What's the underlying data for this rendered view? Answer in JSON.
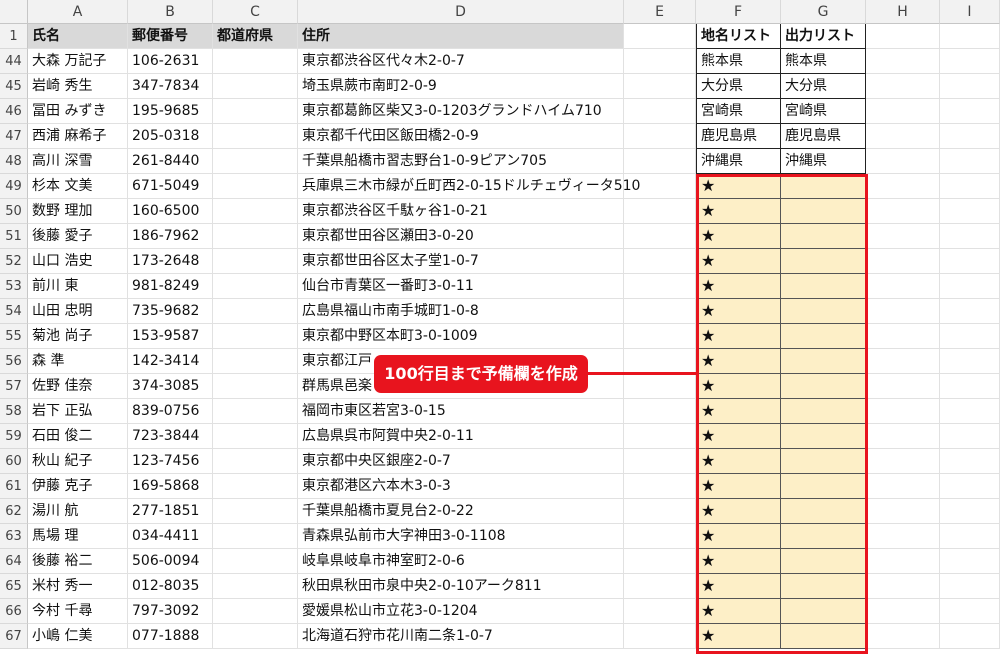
{
  "columns": [
    "A",
    "B",
    "C",
    "D",
    "E",
    "F",
    "G",
    "H",
    "I"
  ],
  "header_row": {
    "num": "1",
    "A": "氏名",
    "B": "郵便番号",
    "C": "都道府県",
    "D": "住所",
    "F": "地名リスト",
    "G": "出力リスト"
  },
  "rows": [
    {
      "num": "44",
      "name": "大森 万記子",
      "zip": "106-2631",
      "addr": "東京都渋谷区代々木2-0-7",
      "f": "熊本県",
      "g": "熊本県"
    },
    {
      "num": "45",
      "name": "岩崎 秀生",
      "zip": "347-7834",
      "addr": "埼玉県蕨市南町2-0-9",
      "f": "大分県",
      "g": "大分県"
    },
    {
      "num": "46",
      "name": "冨田 みずき",
      "zip": "195-9685",
      "addr": "東京都葛飾区柴又3-0-1203グランドハイム710",
      "f": "宮崎県",
      "g": "宮崎県"
    },
    {
      "num": "47",
      "name": "西浦 麻希子",
      "zip": "205-0318",
      "addr": "東京都千代田区飯田橋2-0-9",
      "f": "鹿児島県",
      "g": "鹿児島県"
    },
    {
      "num": "48",
      "name": "高川 深雪",
      "zip": "261-8440",
      "addr": "千葉県船橋市習志野台1-0-9ピアン705",
      "f": "沖縄県",
      "g": "沖縄県"
    },
    {
      "num": "49",
      "name": "杉本 文美",
      "zip": "671-5049",
      "addr": "兵庫県三木市緑が丘町西2-0-15ドルチェヴィータ510",
      "f": "★",
      "g": ""
    },
    {
      "num": "50",
      "name": "数野 理加",
      "zip": "160-6500",
      "addr": "東京都渋谷区千駄ヶ谷1-0-21",
      "f": "★",
      "g": ""
    },
    {
      "num": "51",
      "name": "後藤 愛子",
      "zip": "186-7962",
      "addr": "東京都世田谷区瀬田3-0-20",
      "f": "★",
      "g": ""
    },
    {
      "num": "52",
      "name": "山口 浩史",
      "zip": "173-2648",
      "addr": "東京都世田谷区太子堂1-0-7",
      "f": "★",
      "g": ""
    },
    {
      "num": "53",
      "name": "前川 東",
      "zip": "981-8249",
      "addr": "仙台市青葉区一番町3-0-11",
      "f": "★",
      "g": ""
    },
    {
      "num": "54",
      "name": "山田 忠明",
      "zip": "735-9682",
      "addr": "広島県福山市南手城町1-0-8",
      "f": "★",
      "g": ""
    },
    {
      "num": "55",
      "name": "菊池 尚子",
      "zip": "153-9587",
      "addr": "東京都中野区本町3-0-1009",
      "f": "★",
      "g": ""
    },
    {
      "num": "56",
      "name": "森 準",
      "zip": "142-3414",
      "addr": "東京都江戸",
      "f": "★",
      "g": ""
    },
    {
      "num": "57",
      "name": "佐野 佳奈",
      "zip": "374-3085",
      "addr": "群馬県邑楽",
      "f": "★",
      "g": ""
    },
    {
      "num": "58",
      "name": "岩下 正弘",
      "zip": "839-0756",
      "addr": "福岡市東区若宮3-0-15",
      "f": "★",
      "g": ""
    },
    {
      "num": "59",
      "name": "石田 俊二",
      "zip": "723-3844",
      "addr": "広島県呉市阿賀中央2-0-11",
      "f": "★",
      "g": ""
    },
    {
      "num": "60",
      "name": "秋山 紀子",
      "zip": "123-7456",
      "addr": "東京都中央区銀座2-0-7",
      "f": "★",
      "g": ""
    },
    {
      "num": "61",
      "name": "伊藤 克子",
      "zip": "169-5868",
      "addr": "東京都港区六本木3-0-3",
      "f": "★",
      "g": ""
    },
    {
      "num": "62",
      "name": "湯川 航",
      "zip": "277-1851",
      "addr": "千葉県船橋市夏見台2-0-22",
      "f": "★",
      "g": ""
    },
    {
      "num": "63",
      "name": "馬場 理",
      "zip": "034-4411",
      "addr": "青森県弘前市大字神田3-0-1108",
      "f": "★",
      "g": ""
    },
    {
      "num": "64",
      "name": "後藤 裕二",
      "zip": "506-0094",
      "addr": "岐阜県岐阜市神室町2-0-6",
      "f": "★",
      "g": ""
    },
    {
      "num": "65",
      "name": "米村 秀一",
      "zip": "012-8035",
      "addr": "秋田県秋田市泉中央2-0-10アーク811",
      "f": "★",
      "g": ""
    },
    {
      "num": "66",
      "name": "今村 千尋",
      "zip": "797-3092",
      "addr": "愛媛県松山市立花3-0-1204",
      "f": "★",
      "g": ""
    },
    {
      "num": "67",
      "name": "小嶋 仁美",
      "zip": "077-1888",
      "addr": "北海道石狩市花川南二条1-0-7",
      "f": "★",
      "g": ""
    }
  ],
  "callout": {
    "text": "100行目まで予備欄を作成"
  },
  "colors": {
    "accent_red": "#e8141e",
    "highlight_fill": "#fdefc7"
  }
}
